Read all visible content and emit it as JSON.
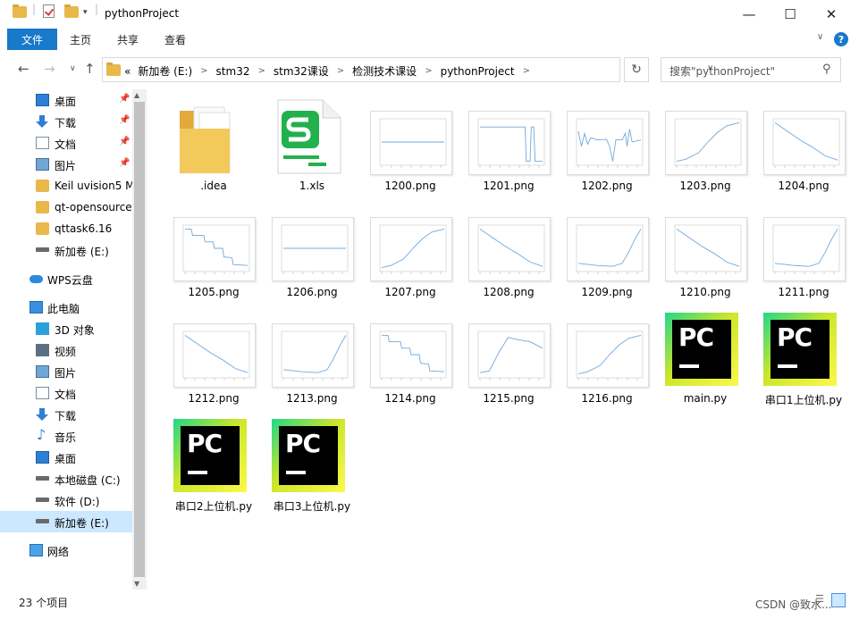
{
  "window": {
    "title": "pythonProject",
    "minimize": "—",
    "maximize": "☐",
    "close": "✕"
  },
  "ribbon": {
    "tabs": [
      "文件",
      "主页",
      "共享",
      "查看"
    ],
    "help": "?"
  },
  "address": {
    "back": "←",
    "forward": "→",
    "recent": "∨",
    "up": "↑",
    "overflow": "«",
    "crumbs": [
      "新加卷 (E:)",
      "stm32",
      "stm32课设",
      "检测技术课设",
      "pythonProject"
    ],
    "refresh": "↻",
    "search_placeholder": "搜索\"pythonProject\""
  },
  "sidebar": {
    "quick": [
      {
        "label": "桌面",
        "icon": "desktop-icon",
        "pinned": true
      },
      {
        "label": "下载",
        "icon": "download-icon",
        "pinned": true
      },
      {
        "label": "文档",
        "icon": "document-icon",
        "pinned": true
      },
      {
        "label": "图片",
        "icon": "pictures-icon",
        "pinned": true
      },
      {
        "label": "Keil uvision5 M",
        "icon": "folder-icon",
        "pinned": false
      },
      {
        "label": "qt-opensource",
        "icon": "folder-icon",
        "pinned": false
      },
      {
        "label": "qttask6.16",
        "icon": "folder-icon",
        "pinned": false
      },
      {
        "label": "新加卷 (E:)",
        "icon": "drive-icon",
        "pinned": false
      }
    ],
    "wps": "WPS云盘",
    "thispc": "此电脑",
    "pc_items": [
      {
        "label": "3D 对象",
        "icon": "3d-objects-icon"
      },
      {
        "label": "视频",
        "icon": "videos-icon"
      },
      {
        "label": "图片",
        "icon": "pictures-icon"
      },
      {
        "label": "文档",
        "icon": "document-icon"
      },
      {
        "label": "下载",
        "icon": "download-icon"
      },
      {
        "label": "音乐",
        "icon": "music-icon"
      },
      {
        "label": "桌面",
        "icon": "desktop-icon"
      },
      {
        "label": "本地磁盘 (C:)",
        "icon": "drive-icon"
      },
      {
        "label": "软件 (D:)",
        "icon": "drive-icon"
      },
      {
        "label": "新加卷 (E:)",
        "icon": "drive-icon"
      }
    ],
    "network": "网络"
  },
  "files": [
    {
      "name": ".idea",
      "type": "folder"
    },
    {
      "name": "1.xls",
      "type": "xls"
    },
    {
      "name": "1200.png",
      "type": "png",
      "plot": "flat"
    },
    {
      "name": "1201.png",
      "type": "png",
      "plot": "drop"
    },
    {
      "name": "1202.png",
      "type": "png",
      "plot": "noisy"
    },
    {
      "name": "1203.png",
      "type": "png",
      "plot": "rise"
    },
    {
      "name": "1204.png",
      "type": "png",
      "plot": "fall"
    },
    {
      "name": "1205.png",
      "type": "png",
      "plot": "steps"
    },
    {
      "name": "1206.png",
      "type": "png",
      "plot": "flat"
    },
    {
      "name": "1207.png",
      "type": "png",
      "plot": "rise"
    },
    {
      "name": "1208.png",
      "type": "png",
      "plot": "fall"
    },
    {
      "name": "1209.png",
      "type": "png",
      "plot": "hockey"
    },
    {
      "name": "1210.png",
      "type": "png",
      "plot": "fall"
    },
    {
      "name": "1211.png",
      "type": "png",
      "plot": "hockey"
    },
    {
      "name": "1212.png",
      "type": "png",
      "plot": "fall"
    },
    {
      "name": "1213.png",
      "type": "png",
      "plot": "hockey"
    },
    {
      "name": "1214.png",
      "type": "png",
      "plot": "steps"
    },
    {
      "name": "1215.png",
      "type": "png",
      "plot": "peak"
    },
    {
      "name": "1216.png",
      "type": "png",
      "plot": "rise"
    },
    {
      "name": "main.py",
      "type": "py"
    },
    {
      "name": "串口1上位机.py",
      "type": "py"
    },
    {
      "name": "串口2上位机.py",
      "type": "py"
    },
    {
      "name": "串口3上位机.py",
      "type": "py"
    }
  ],
  "status": {
    "count": "23 个项目",
    "watermark": "CSDN @致水..."
  },
  "colors": {
    "accent": "#1979ca",
    "selection": "#cce8ff",
    "folder": "#e8b84a",
    "plot_line": "#6fa8dc"
  }
}
